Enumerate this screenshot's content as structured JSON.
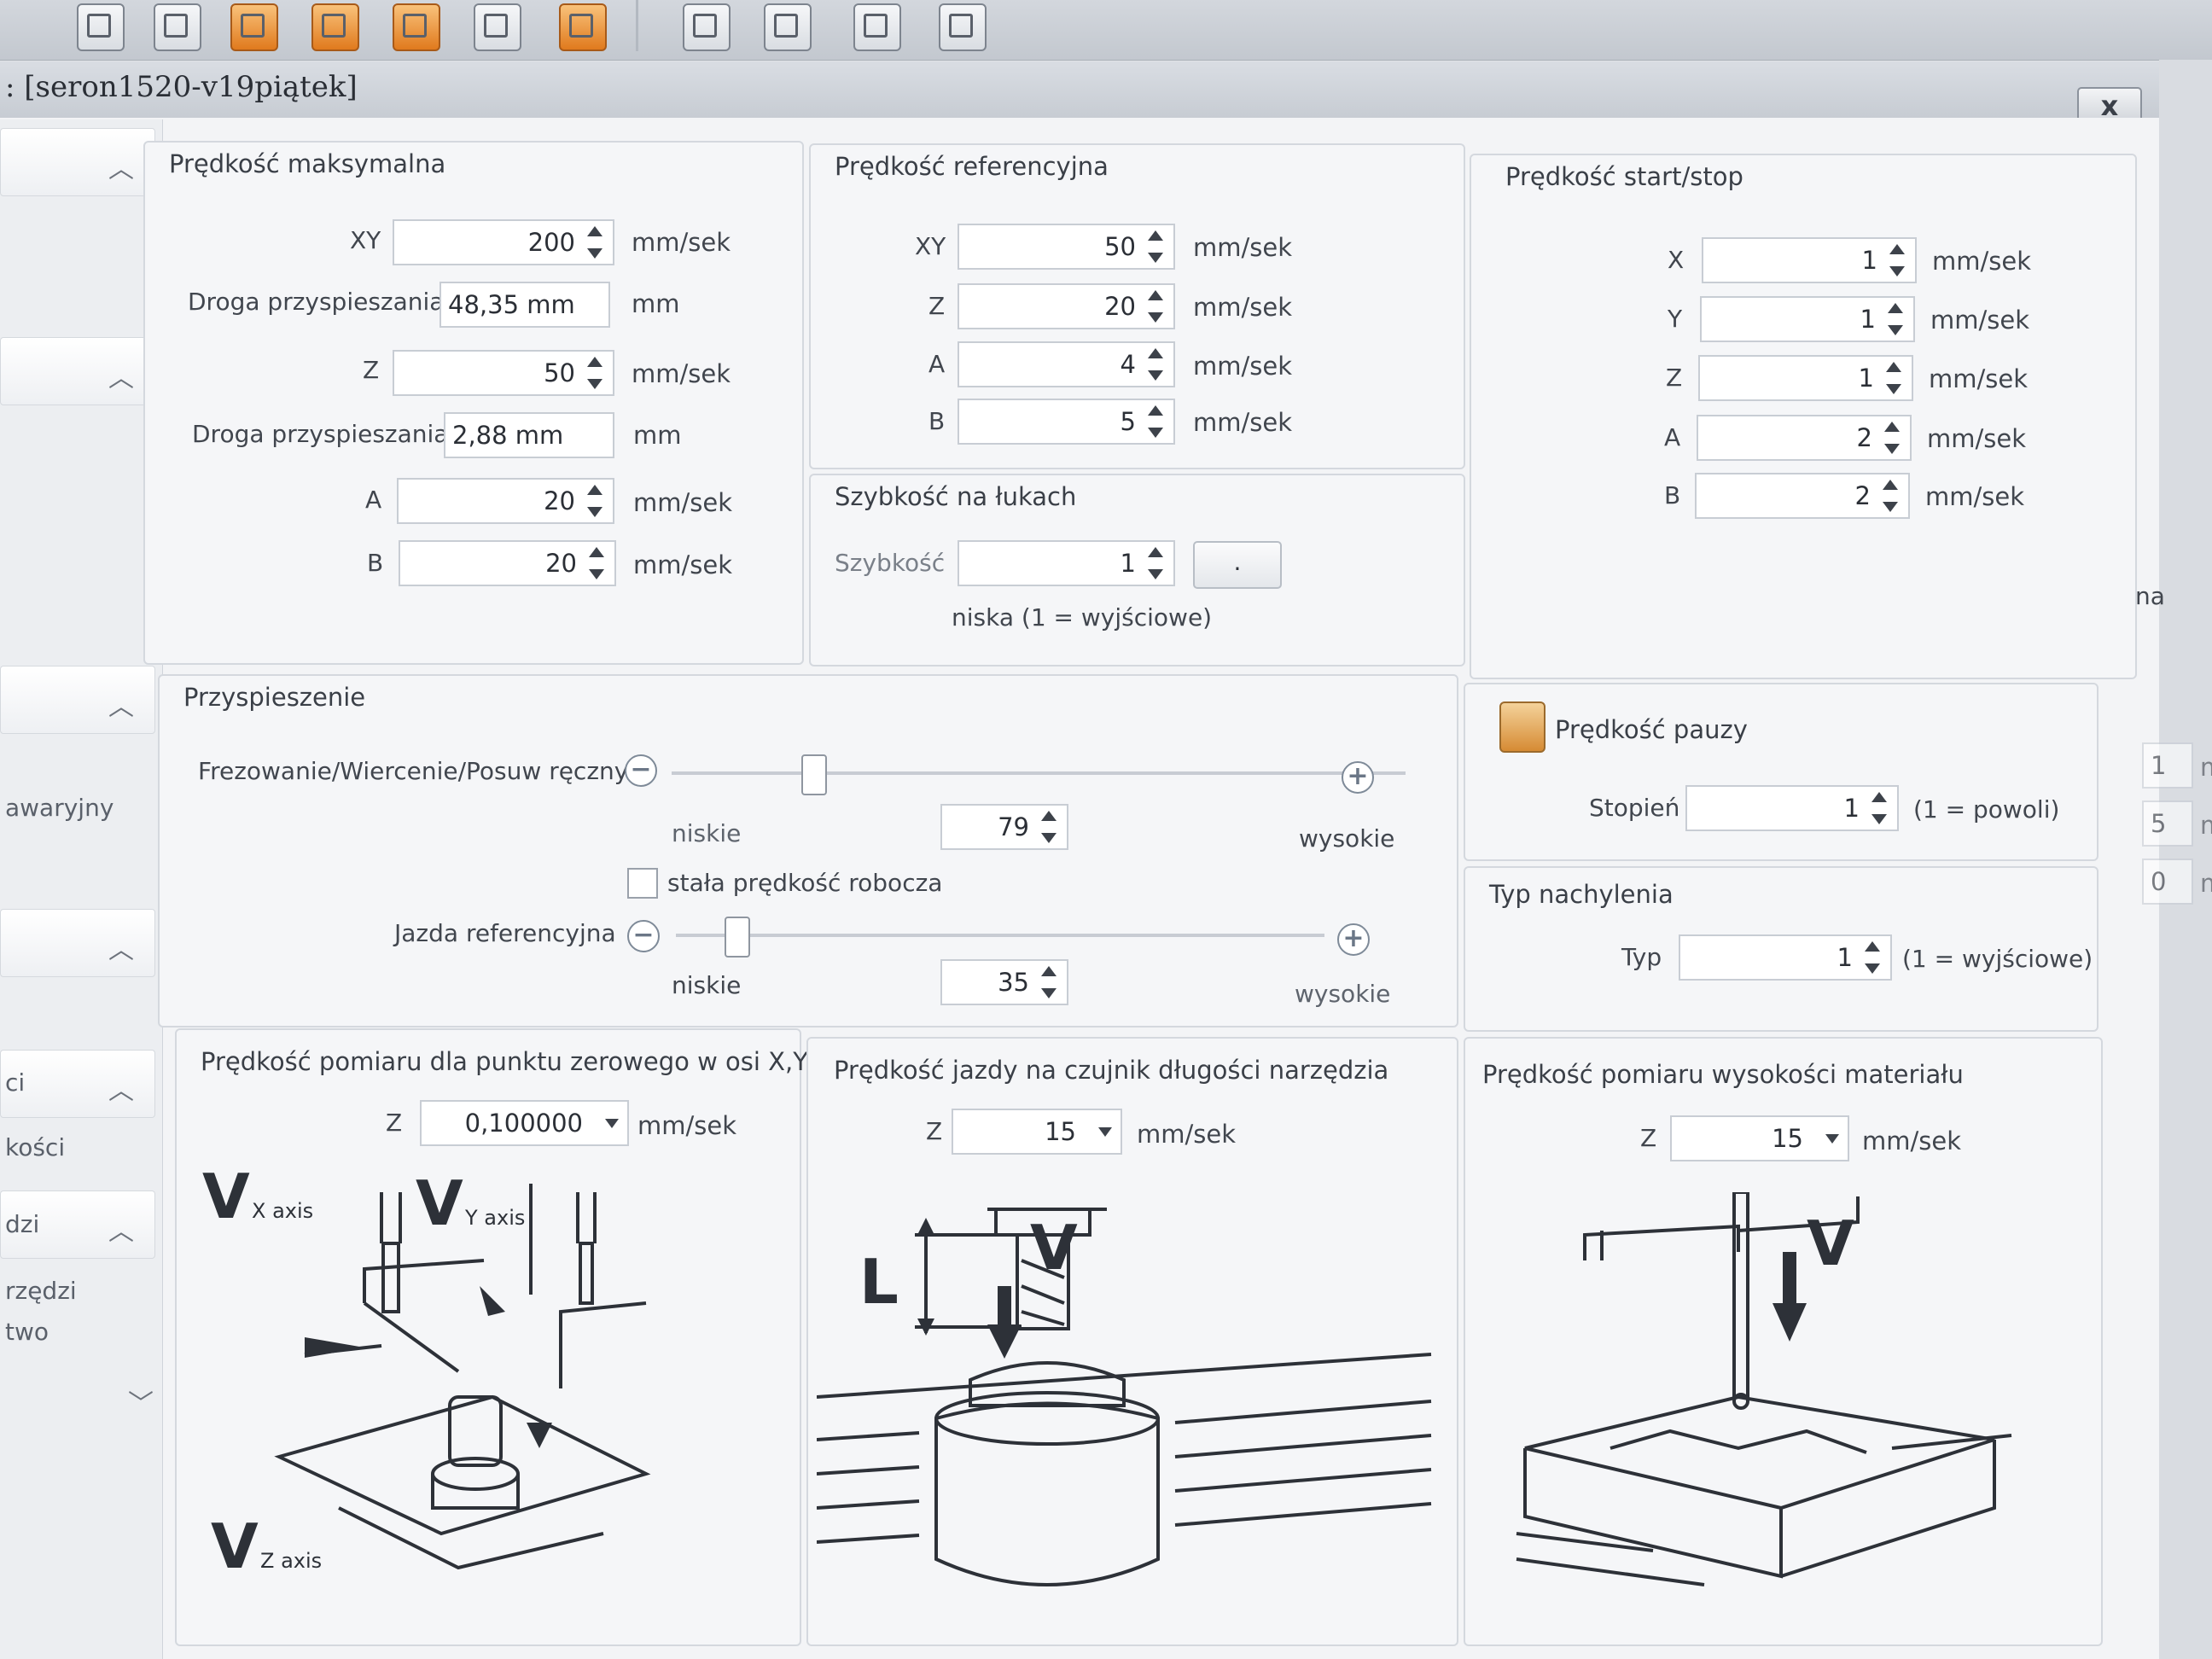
{
  "window": {
    "title": ": [seron1520-v19piątek]",
    "close_label": "x"
  },
  "toolbar": {
    "icons": [
      "tool-icon",
      "tool-icon",
      "tool-icon",
      "tool-icon",
      "tool-icon",
      "tool-icon",
      "stop-icon",
      "tool-icon",
      "tool-icon",
      "tool-icon",
      "tool-icon"
    ]
  },
  "sidebar": {
    "items": [
      "awaryjny",
      "ci",
      "kości",
      "dzi",
      "rzędzi",
      "two"
    ]
  },
  "max_speed": {
    "title": "Prędkość maksymalna",
    "xy": {
      "label": "XY",
      "value": "200",
      "unit": "mm/sek"
    },
    "accel_xy": {
      "label": "Droga przyspieszania",
      "value": "48,35 mm",
      "unit": "mm"
    },
    "z": {
      "label": "Z",
      "value": "50",
      "unit": "mm/sek"
    },
    "accel_z": {
      "label": "Droga przyspieszania",
      "value": "2,88 mm",
      "unit": "mm"
    },
    "a": {
      "label": "A",
      "value": "20",
      "unit": "mm/sek"
    },
    "b": {
      "label": "B",
      "value": "20",
      "unit": "mm/sek"
    }
  },
  "ref_speed": {
    "title": "Prędkość referencyjna",
    "xy": {
      "label": "XY",
      "value": "50",
      "unit": "mm/sek"
    },
    "z": {
      "label": "Z",
      "value": "20",
      "unit": "mm/sek"
    },
    "a": {
      "label": "A",
      "value": "4",
      "unit": "mm/sek"
    },
    "b": {
      "label": "B",
      "value": "5",
      "unit": "mm/sek"
    }
  },
  "arc_speed": {
    "title": "Szybkość na łukach",
    "label": "Szybkość",
    "value": "1",
    "button": ".",
    "note": "niska (1 = wyjściowe)"
  },
  "startstop": {
    "title": "Prędkość start/stop",
    "x": {
      "label": "X",
      "value": "1",
      "unit": "mm/sek"
    },
    "y": {
      "label": "Y",
      "value": "1",
      "unit": "mm/sek"
    },
    "z": {
      "label": "Z",
      "value": "1",
      "unit": "mm/sek"
    },
    "a": {
      "label": "A",
      "value": "2",
      "unit": "mm/sek"
    },
    "b": {
      "label": "B",
      "value": "2",
      "unit": "mm/sek"
    }
  },
  "offscreen": {
    "label": "na",
    "values": [
      "1",
      "5",
      "0"
    ],
    "unit": "m"
  },
  "accel": {
    "title": "Przyspieszenie",
    "milling": {
      "label": "Frezowanie/Wiercenie/Posuw ręczny",
      "low": "niskie",
      "high": "wysokie",
      "value": "79",
      "level": 0.79
    },
    "const_speed": {
      "label": "stała prędkość robocza",
      "checked": false
    },
    "referencing": {
      "label": "Jazda referencyjna",
      "low": "niskie",
      "high": "wysokie",
      "value": "35",
      "level": 0.35
    }
  },
  "pause_speed": {
    "title": "Prędkość pauzy",
    "label": "Stopień",
    "value": "1",
    "note": "(1 = powoli)"
  },
  "ramp_type": {
    "title": "Typ nachylenia",
    "label": "Typ",
    "value": "1",
    "note": "(1 = wyjściowe)"
  },
  "zero_probe": {
    "title": "Prędkość pomiaru dla punktu zerowego w osi X,Y i Z",
    "label": "Z",
    "value": "0,100000",
    "unit": "mm/sek",
    "vx": "V",
    "vx_sub": "X axis",
    "vy": "V",
    "vy_sub": "Y axis",
    "vz": "V",
    "vz_sub": "Z axis"
  },
  "tool_sensor": {
    "title": "Prędkość jazdy na czujnik długości narzędzia",
    "label": "Z",
    "value": "15",
    "unit": "mm/sek",
    "l_label": "L",
    "v_label": "V"
  },
  "material_height": {
    "title": "Prędkość pomiaru wysokości materiału",
    "label": "Z",
    "value": "15",
    "unit": "mm/sek",
    "v_label": "V"
  }
}
